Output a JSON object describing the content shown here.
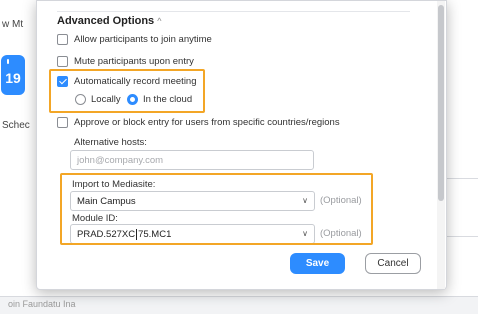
{
  "background": {
    "window_title_partial": "w Mt",
    "calendar_day": "19",
    "schedule_partial": "Schec",
    "footer_partial": "oin Faundatu Ina"
  },
  "dialog": {
    "section_title": "Advanced Options",
    "options": {
      "join_anytime": "Allow participants to join anytime",
      "mute_entry": "Mute participants upon entry",
      "auto_record": "Automatically record meeting",
      "record_locally": "Locally",
      "record_cloud": "In the cloud",
      "approve_block": "Approve or block entry for users from specific countries/regions"
    },
    "alt_hosts": {
      "label": "Alternative hosts:",
      "placeholder": "john@company.com"
    },
    "mediasite": {
      "import_label": "Import to Mediasite:",
      "import_value": "Main Campus",
      "import_optional": "(Optional)",
      "module_label": "Module ID:",
      "module_value_before_cursor": "PRAD.527XC",
      "module_value_after_cursor": "75.MC1",
      "module_optional": "(Optional)"
    },
    "buttons": {
      "save": "Save",
      "cancel": "Cancel"
    }
  },
  "colors": {
    "accent": "#2d8cff",
    "highlight": "#f3a626"
  },
  "icons": {
    "caret": "caret-up-icon",
    "chevron": "chevron-down-icon",
    "calendar": "calendar-icon"
  }
}
